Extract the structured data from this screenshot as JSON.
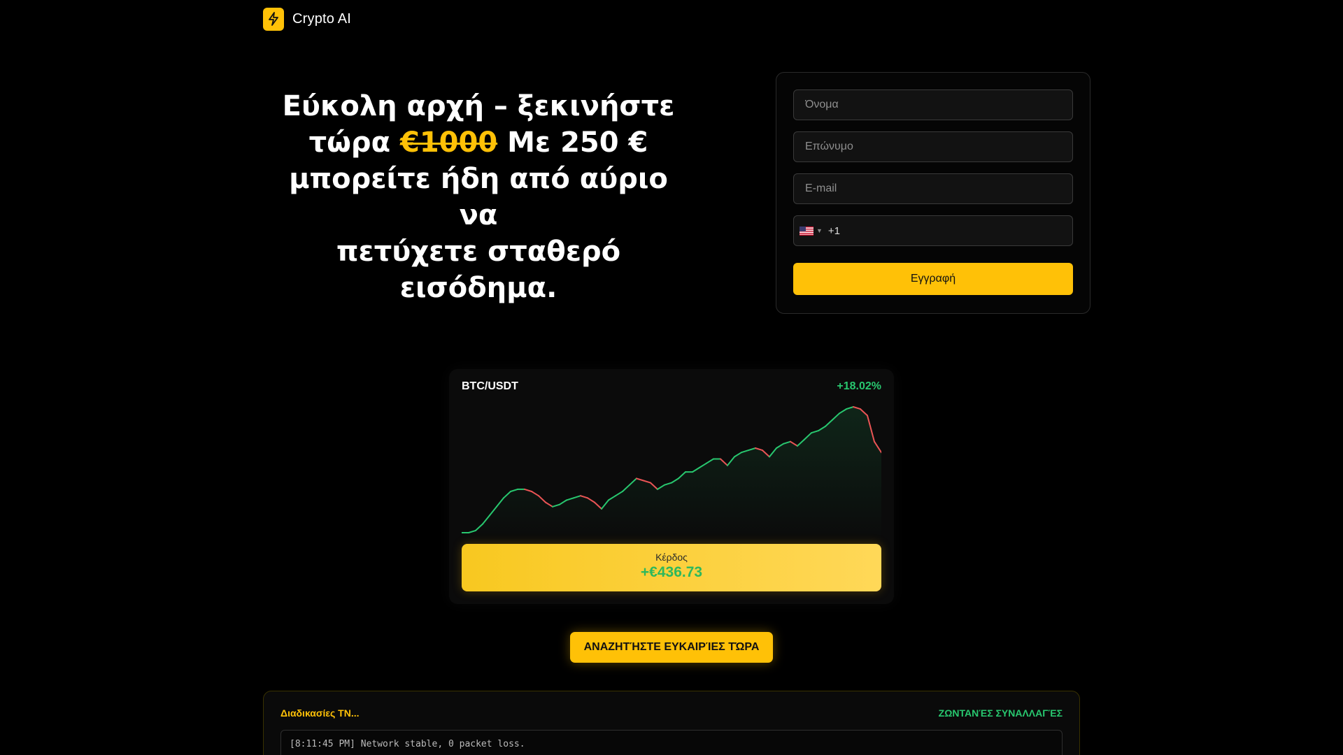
{
  "brand": {
    "name": "Crypto AI",
    "icon": "lightning-icon"
  },
  "hero": {
    "line1": "Εύκολη αρχή – ξεκινήστε",
    "line2_pre": "τώρα",
    "line2_strike": "€1000",
    "line2_post": "Με 250 €",
    "line3": "μπορείτε ήδη από αύριο να",
    "line4": "πετύχετε σταθερό εισόδημα."
  },
  "form": {
    "first_name_placeholder": "Όνομα",
    "last_name_placeholder": "Επώνυμο",
    "email_placeholder": "E-mail",
    "phone_dial_code": "+1",
    "phone_flag": "us-flag-icon",
    "submit_label": "Εγγραφή"
  },
  "chart_card": {
    "pair": "BTC/USDT",
    "change": "+18.02%",
    "profit_label": "Κέρδος",
    "profit_value": "+€436.73"
  },
  "chart_data": {
    "type": "line",
    "title": "BTC/USDT",
    "x": [
      0,
      1,
      2,
      3,
      4,
      5,
      6,
      7,
      8,
      9,
      10,
      11,
      12,
      13,
      14,
      15,
      16,
      17,
      18,
      19,
      20,
      21,
      22,
      23,
      24,
      25,
      26,
      27,
      28,
      29,
      30,
      31,
      32,
      33,
      34,
      35,
      36,
      37,
      38,
      39,
      40,
      41,
      42,
      43,
      44,
      45,
      46,
      47,
      48,
      49,
      50,
      51,
      52,
      53,
      54,
      55,
      56,
      57,
      58,
      59,
      60
    ],
    "values": [
      3,
      3,
      4,
      7,
      11,
      15,
      19,
      22,
      23,
      23,
      22,
      20,
      17,
      15,
      16,
      18,
      19,
      20,
      19,
      17,
      14,
      18,
      20,
      22,
      25,
      28,
      27,
      26,
      23,
      25,
      26,
      28,
      31,
      31,
      33,
      35,
      37,
      37,
      34,
      38,
      40,
      41,
      42,
      41,
      38,
      42,
      44,
      45,
      43,
      46,
      49,
      50,
      52,
      55,
      58,
      60,
      61,
      60,
      57,
      45,
      40
    ],
    "up_color": "#28c76f",
    "down_color": "#ea5455"
  },
  "cta": {
    "label": "ΑΝΑΖΗΤΉΣΤΕ ΕΥΚΑΙΡΊΕΣ ΤΏΡΑ"
  },
  "terminal": {
    "title": "Διαδικασίες TN...",
    "live_label": "ΖΩΝΤΑΝΈΣ ΣΥΝΑΛΛΑΓΈΣ",
    "log_lines": [
      "[8:11:45 PM] Network stable, 0 packet loss."
    ]
  },
  "colors": {
    "accent": "#ffc107",
    "positive": "#28c76f",
    "negative": "#ea5455",
    "background": "#000000"
  }
}
